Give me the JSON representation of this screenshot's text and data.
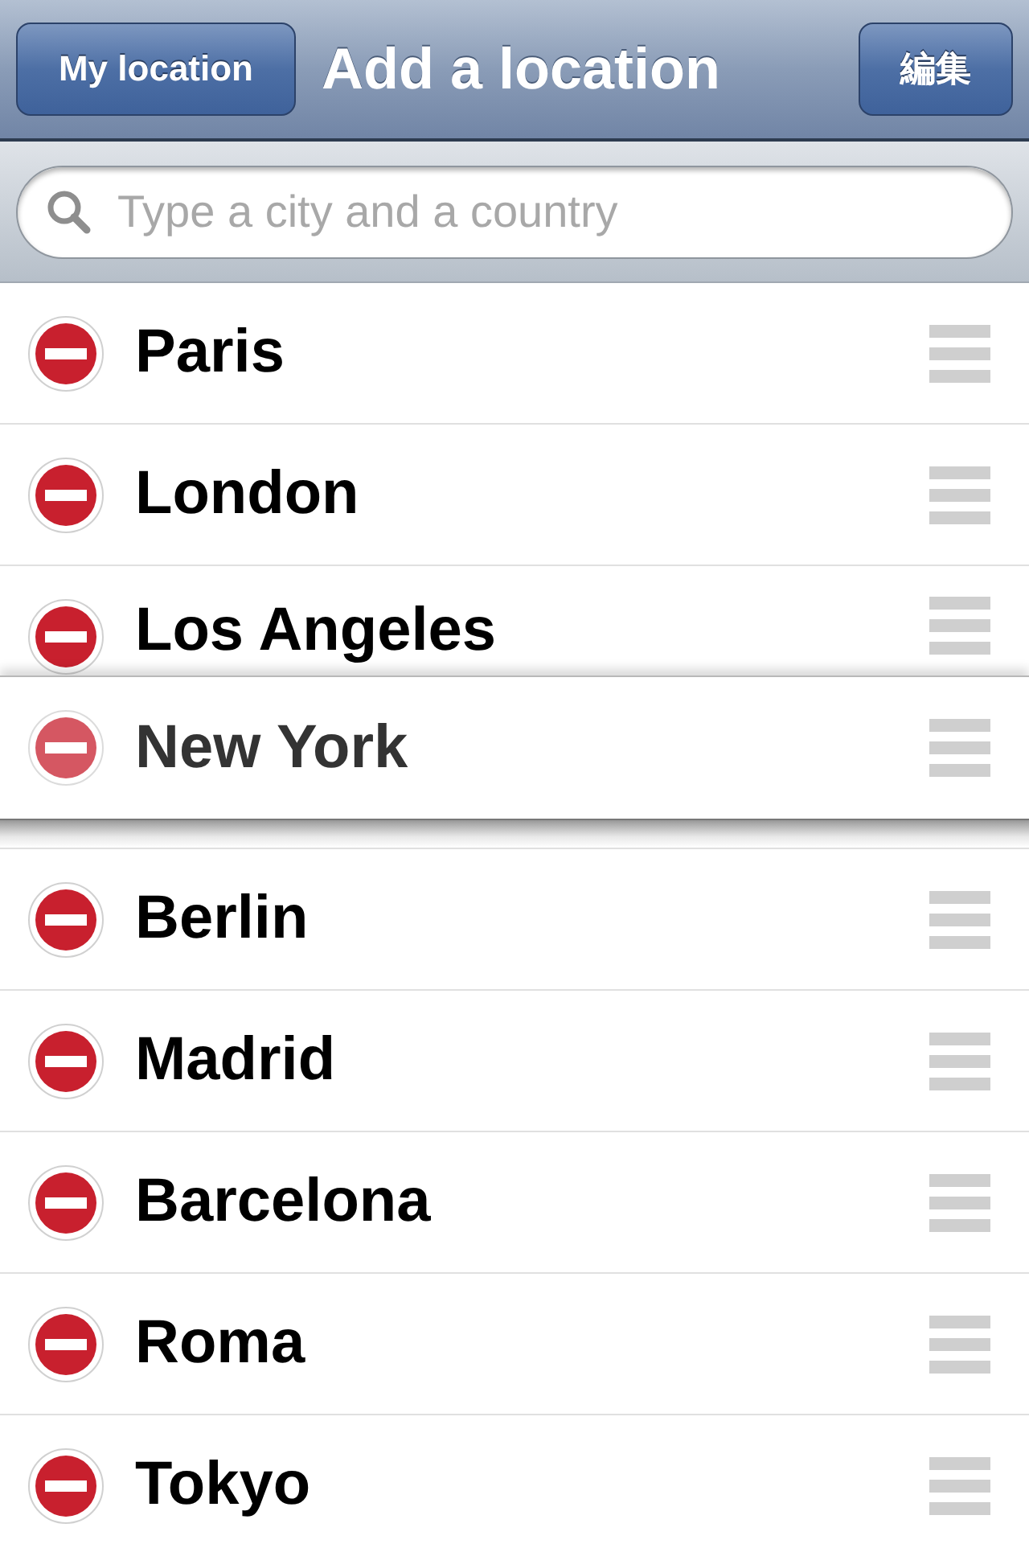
{
  "nav_bar": {
    "left_button": "My location",
    "title": "Add a location",
    "right_button": "編集"
  },
  "search": {
    "placeholder": "Type a city and a country"
  },
  "locations": [
    {
      "name": "Paris",
      "dragging": false
    },
    {
      "name": "London",
      "dragging": false
    },
    {
      "name": "Los Angeles",
      "dragging": false
    },
    {
      "name": "New York",
      "dragging": true
    },
    {
      "name": "Berlin",
      "dragging": false
    },
    {
      "name": "Madrid",
      "dragging": false
    },
    {
      "name": "Barcelona",
      "dragging": false
    },
    {
      "name": "Roma",
      "dragging": false
    },
    {
      "name": "Tokyo",
      "dragging": false
    }
  ]
}
